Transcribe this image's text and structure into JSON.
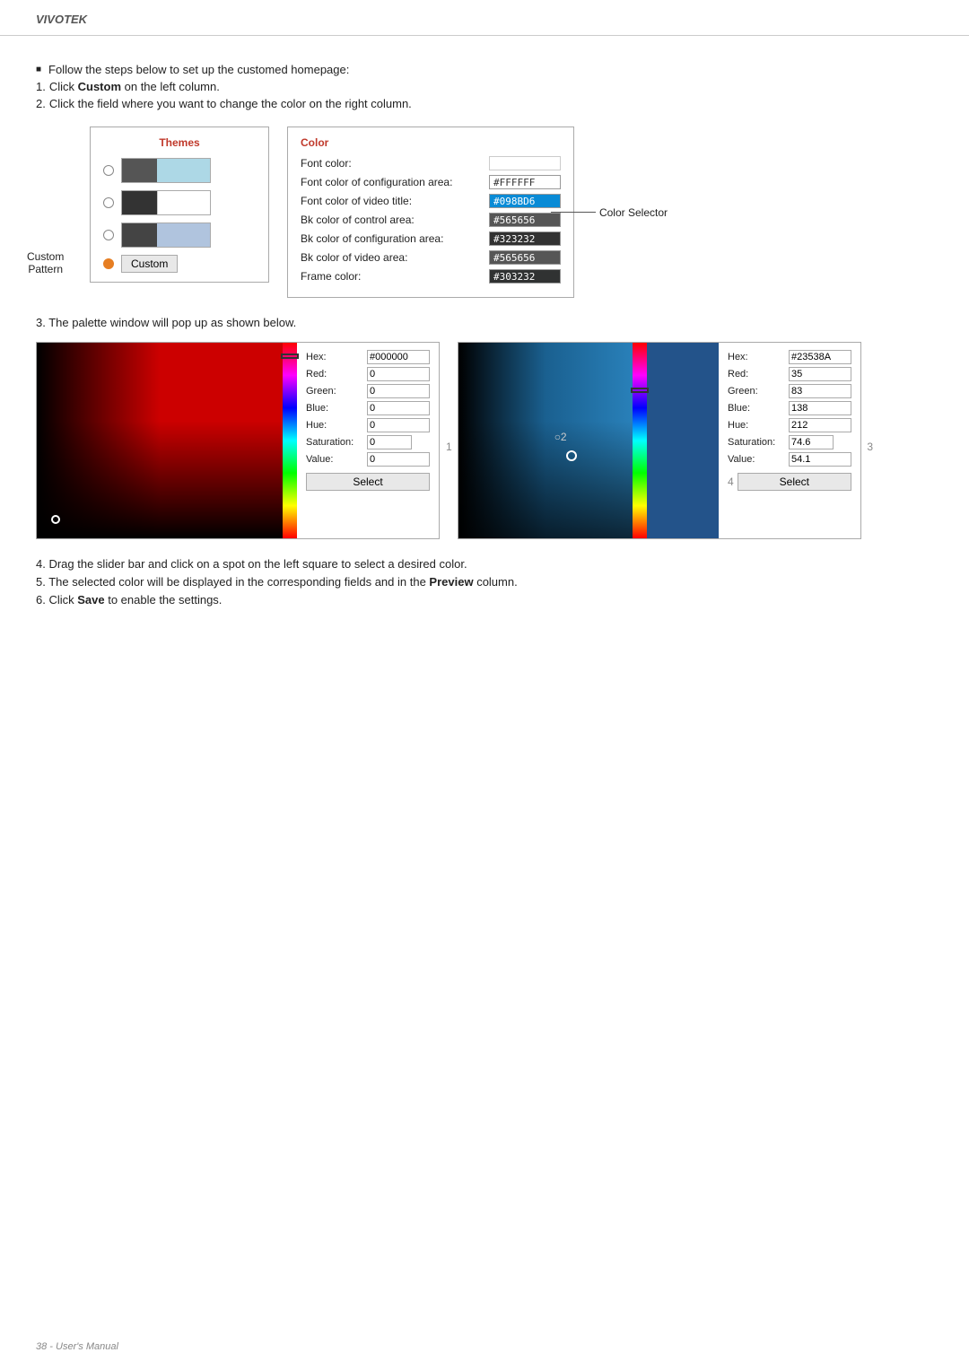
{
  "header": {
    "brand": "VIVOTEK"
  },
  "intro": {
    "bullet": "Follow the steps below to set up the customed homepage:",
    "step1": "Click Custom on the left column.",
    "step2": "Click the field where you want to change the color on the right column."
  },
  "themes_panel": {
    "title": "Themes",
    "custom_button": "Custom",
    "custom_pattern_label": "Custom\nPattern"
  },
  "color_panel": {
    "title": "Color",
    "color_selector_label": "Color Selector",
    "rows": [
      {
        "label": "Font color:",
        "value": "",
        "bg": "#ffffff",
        "show_text": false
      },
      {
        "label": "Font color of configuration area:",
        "value": "#FFFFFF",
        "bg": "#ffffff"
      },
      {
        "label": "Font color of video title:",
        "value": "#098BD6",
        "bg": "#098BD6"
      },
      {
        "label": "Bk color of control area:",
        "value": "#565656",
        "bg": "#565656"
      },
      {
        "label": "Bk color of configuration area:",
        "value": "#323232",
        "bg": "#323232"
      },
      {
        "label": "Bk color of video area:",
        "value": "#565656",
        "bg": "#565656"
      },
      {
        "label": "Frame color:",
        "value": "#303232",
        "bg": "#303232"
      }
    ]
  },
  "step3": {
    "title": "3. The palette window will pop up as shown below."
  },
  "palette_left": {
    "hex_label": "Hex:",
    "hex_value": "#000000",
    "red_label": "Red:",
    "red_value": "0",
    "green_label": "Green:",
    "green_value": "0",
    "blue_label": "Blue:",
    "blue_value": "0",
    "hue_label": "Hue:",
    "hue_value": "0",
    "sat_label": "Saturation:",
    "sat_value": "0",
    "val_label": "Value:",
    "val_value": "0",
    "select_btn": "Select"
  },
  "palette_right": {
    "hex_label": "Hex:",
    "hex_value": "#23538A",
    "red_label": "Red:",
    "red_value": "35",
    "green_label": "Green:",
    "green_value": "83",
    "blue_label": "Blue:",
    "blue_value": "138",
    "hue_label": "Hue:",
    "hue_value": "212",
    "sat_label": "Saturation:",
    "sat_value": "74.6",
    "val_label": "Value:",
    "val_value": "54.1",
    "select_btn": "Select",
    "anno_2": "○2",
    "anno_1": "1",
    "anno_3": "3",
    "anno_4": "4"
  },
  "steps_bottom": {
    "step4": "4. Drag the slider bar and click on a spot on the left square to select a desired color.",
    "step5_pre": "5. The selected color will be displayed in the corresponding fields and in the ",
    "step5_bold": "Preview",
    "step5_post": " column.",
    "step6_pre": "6. Click ",
    "step6_bold": "Save",
    "step6_post": " to enable the settings."
  },
  "footer": {
    "text": "38 - User's Manual"
  }
}
